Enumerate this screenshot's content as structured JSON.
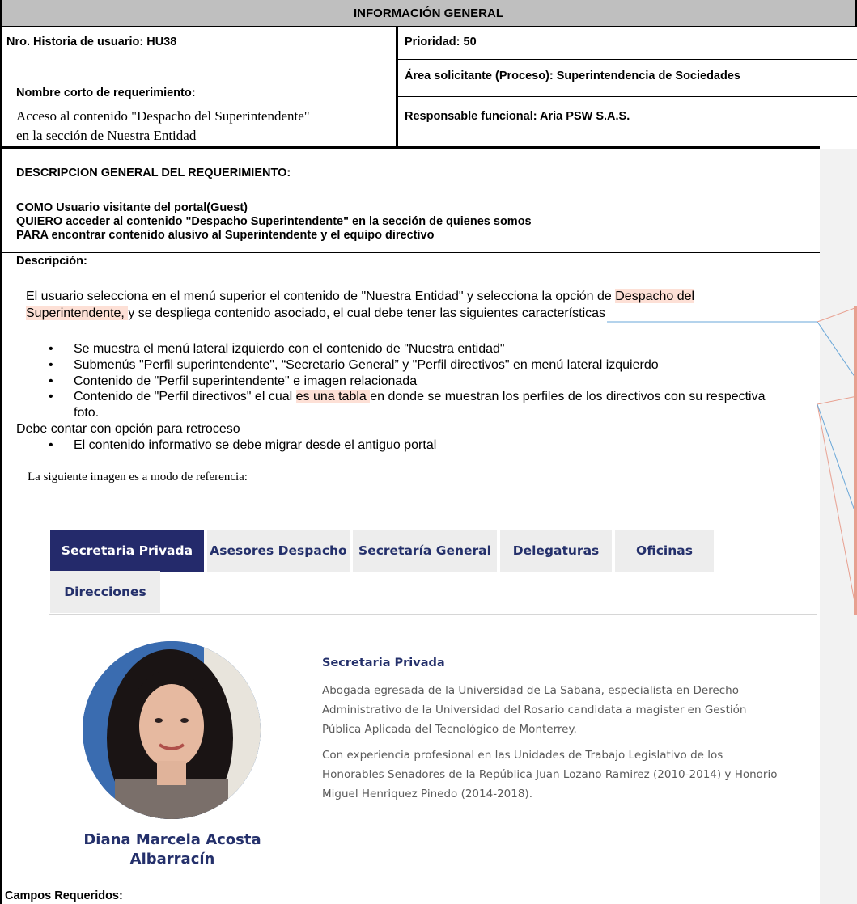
{
  "header": {
    "title": "INFORMACIÓN GENERAL"
  },
  "info": {
    "story_number": "Nro. Historia de usuario:  HU38",
    "priority": "Prioridad:  50",
    "area": "Área solicitante (Proceso): Superintendencia de Sociedades",
    "short_name_label": "Nombre corto de requerimiento:",
    "short_name_line1": "Acceso al contenido \"Despacho del Superintendente\"",
    "short_name_line2": "en la sección de Nuestra Entidad",
    "responsible": "Responsable funcional: Aria PSW S.A.S."
  },
  "general": {
    "heading": "DESCRIPCION GENERAL DEL REQUERIMIENTO:",
    "como": "COMO Usuario visitante del portal(Guest)",
    "quiero": "QUIERO acceder al contenido  \"Despacho Superintendente\" en la sección de quienes somos",
    "para": "PARA encontrar contenido alusivo al Superintendente y el equipo directivo"
  },
  "description": {
    "label": "Descripción:",
    "p1_a": "El usuario selecciona en el menú superior el contenido de \"Nuestra Entidad\" y selecciona la opción de ",
    "p1_hl1": "Despacho del",
    "p1_hl2": "Superintendente, ",
    "p1_b": "y se  despliega contenido asociado, el cual debe tener las siguientes características",
    "bullets": [
      "Se muestra el menú lateral izquierdo con el contenido de \"Nuestra entidad\"",
      "Submenús \"Perfil superintendente\", “Secretario General” y \"Perfil directivos\" en menú lateral izquierdo",
      "Contenido de \"Perfil superintendente\" e imagen relacionada"
    ],
    "b4_a": "Contenido de \"Perfil directivos\" el cual ",
    "b4_hl": "es una tabla ",
    "b4_b": "en donde se muestran los perfiles de los directivos con su respectiva",
    "b4_c": "foto.",
    "retroceso": "Debe contar con opción para retroceso",
    "bullet5": "El contenido informativo se debe migrar desde el antiguo portal",
    "reference": "La siguiente imagen es a modo de referencia:",
    "bullet_glyph": "•"
  },
  "reference_image": {
    "tabs": [
      "Secretaria Privada",
      "Asesores Despacho",
      "Secretaría General",
      "Delegaturas",
      "Oficinas",
      "Direcciones"
    ],
    "active_tab": "Secretaria Privada",
    "section_title": "Secretaria Privada",
    "para1": [
      "Abogada egresada de la Universidad de La Sabana, especialista en Derecho",
      "Administrativo de la Universidad del Rosario candidata a magister en Gestión",
      "Pública Aplicada del Tecnológico de Monterrey."
    ],
    "para2": [
      "Con experiencia profesional en las Unidades de Trabajo Legislativo de los",
      "Honorables Senadores de la República Juan Lozano Ramirez (2010-2014) y Honorio",
      "Miguel Henriquez Pinedo (2014-2018)."
    ],
    "person_name_line1": "Diana Marcela Acosta",
    "person_name_line2": "Albarracín"
  },
  "required_fields": {
    "label": "Campos Requeridos:"
  },
  "colors": {
    "header_bg": "#bfbfbf",
    "highlight": "#fde0d6",
    "tab_active": "#242a6b",
    "tab_text": "#24306b"
  }
}
